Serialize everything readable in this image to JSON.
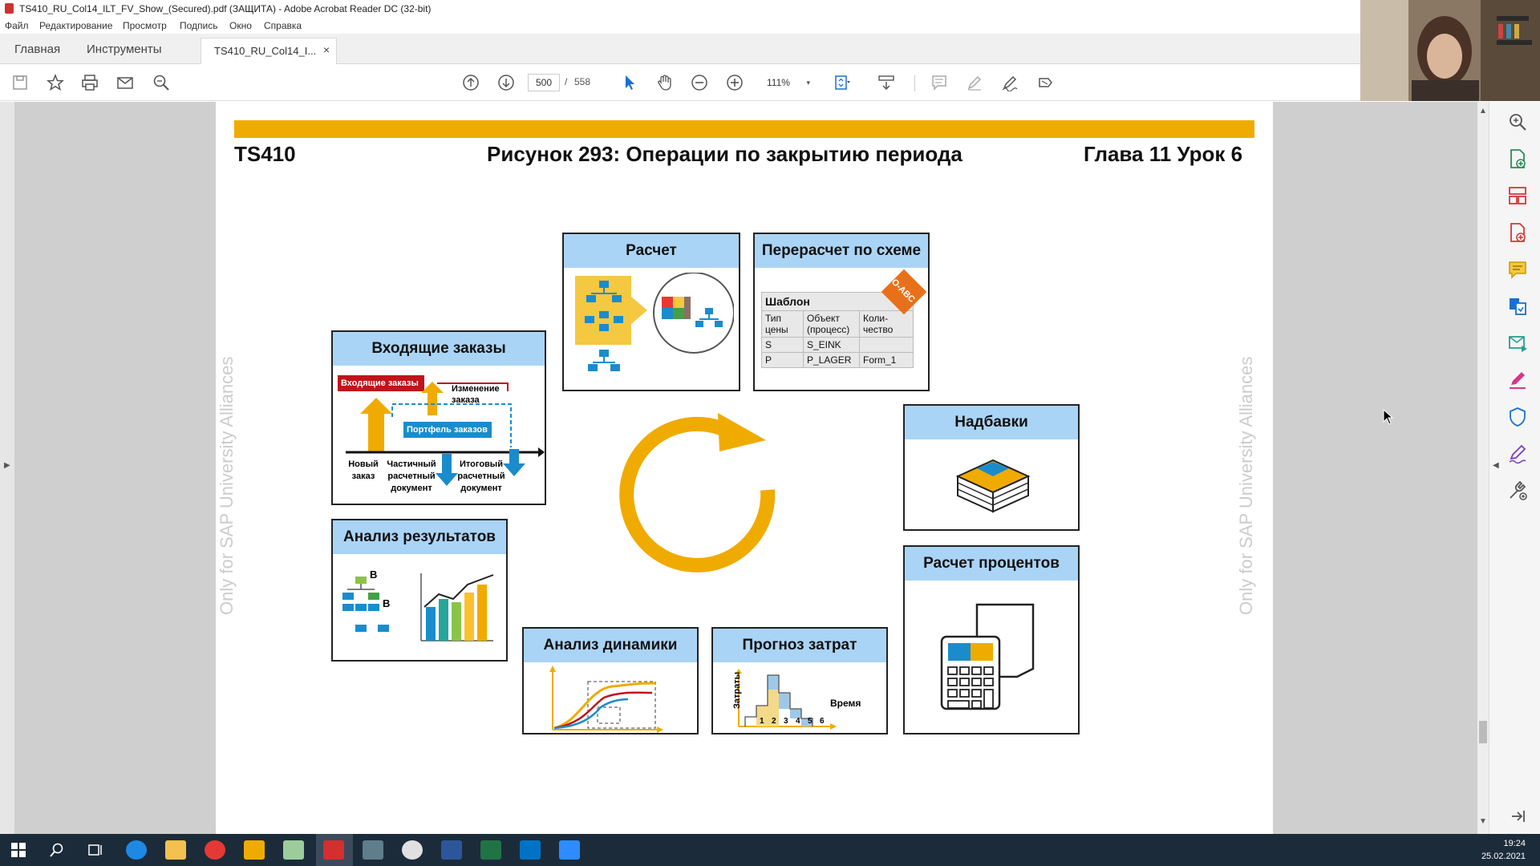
{
  "window": {
    "title": "TS410_RU_Col14_ILT_FV_Show_(Secured).pdf (ЗАЩИТА) - Adobe Acrobat Reader DC (32-bit)"
  },
  "menu": [
    "Файл",
    "Редактирование",
    "Просмотр",
    "Подпись",
    "Окно",
    "Справка"
  ],
  "tabs": {
    "home": "Главная",
    "tools": "Инструменты",
    "document": "TS410_RU_Col14_I...",
    "close": "×"
  },
  "toolbar": {
    "page_current": "500",
    "page_separator": "/",
    "page_total": "558",
    "zoom": "111%",
    "zoom_chevron": "▾"
  },
  "page": {
    "header_left": "TS410",
    "header_center": "Рисунок 293: Операции по закрытию периода",
    "header_right": "Глава 11 Урок 6",
    "watermark": "Only for SAP University Alliances"
  },
  "boxes": {
    "calc": {
      "title": "Расчет"
    },
    "recalc": {
      "title": "Перерасчет по схеме",
      "badge": "CO-ABC",
      "table_head": "Шаблон",
      "columns": [
        "Тип цены",
        "Объект (процесс)",
        "Коли-чество"
      ],
      "rows": [
        [
          "S",
          "S_EINK",
          ""
        ],
        [
          "P",
          "P_LAGER",
          "Form_1"
        ]
      ]
    },
    "orders": {
      "title": "Входящие заказы",
      "incoming": "Входящие заказы",
      "change": "Изменение заказа",
      "portfolio": "Портфель заказов",
      "new_order": "Новый заказ",
      "partial": "Частичный расчетный документ",
      "final": "Итоговый расчетный документ"
    },
    "results": {
      "title": "Анализ результатов",
      "label_b": "B"
    },
    "surcharges": {
      "title": "Надбавки"
    },
    "interest": {
      "title": "Расчет процентов"
    },
    "dynamics": {
      "title": "Анализ динамики"
    },
    "forecast": {
      "title": "Прогноз затрат",
      "ylabel": "Затраты",
      "xlabel": "Время",
      "ticks": [
        "1",
        "2",
        "3",
        "4",
        "5",
        "6"
      ]
    }
  },
  "clock": {
    "time": "19:24",
    "date": "25.02.2021"
  },
  "colors": {
    "accent_orange": "#f0ab00",
    "box_title_blue": "#aad4f5",
    "sap_blue": "#1a8ccc"
  }
}
